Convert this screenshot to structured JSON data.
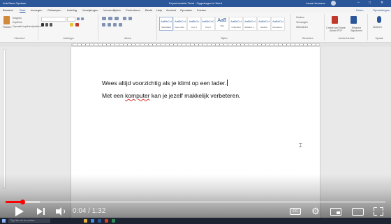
{
  "window": {
    "quick_access": "AutoSave  Opslaan",
    "title": "Experimentele Tekst - Opgeslagen in Word",
    "user": "Laura Hermans",
    "colors": {
      "title_bar": "#2b579a",
      "ribbon": "#f6f6f6",
      "page": "#ffffff"
    }
  },
  "ribbon_tabs": {
    "items": [
      "Bestand",
      "Start",
      "Invoegen",
      "Ontwerpen",
      "Indeling",
      "Verwijzingen",
      "Verzendlijsten",
      "Controleren",
      "Beeld",
      "Help",
      "Acrobat",
      "Opmaken",
      "Zoeken"
    ],
    "active_index": 1,
    "share": "Delen",
    "comments": "Opmerkingen"
  },
  "ribbon": {
    "groups": [
      "Klembord",
      "Lettertype",
      "Alinea",
      "Stijlen",
      "Bewerken",
      "Adobe Acrobat",
      "Spraak"
    ],
    "paste_label": "Plakken",
    "clipboard_items": [
      "Knippen",
      "Kopiëren",
      "Opmaak kopiëren/plakken"
    ],
    "styles": [
      {
        "preview": "AaBbCcI",
        "name": "Standaard"
      },
      {
        "preview": "AaBbCcI",
        "name": "Geen afst..."
      },
      {
        "preview": "AaBbCc",
        "name": "Kop 1"
      },
      {
        "preview": "AaBbCcC",
        "name": "Kop 2"
      },
      {
        "preview": "AaB",
        "name": "Titel"
      },
      {
        "preview": "AaBbCcI",
        "name": "Ondertitel"
      },
      {
        "preview": "AaBbCcI",
        "name": "Subtiele n..."
      },
      {
        "preview": "AaBbCcI",
        "name": "Nadruk"
      },
      {
        "preview": "AaBbCcI",
        "name": "Intensieve..."
      }
    ],
    "editing": [
      "Zoeken",
      "Vervangen",
      "Selecteren"
    ],
    "acrobat": [
      "Create and Share Adobe PDF",
      "Request Signatures"
    ],
    "voice": "Dicteren"
  },
  "document": {
    "line1": "Wees altijd voorzichtig als je klimt op een lader.",
    "line2_before": "Met een ",
    "line2_misspelled": "komputer",
    "line2_after": " kan je jezelf makkelijk verbeteren."
  },
  "player": {
    "time": "0:04 / 1:32",
    "progress_fraction": 0.0435,
    "buffered_fraction": 0.09,
    "cc_label": "CC",
    "colors": {
      "played": "#ff0000"
    }
  },
  "taskbar": {
    "search_placeholder": "Typ hier om te zoeken"
  }
}
